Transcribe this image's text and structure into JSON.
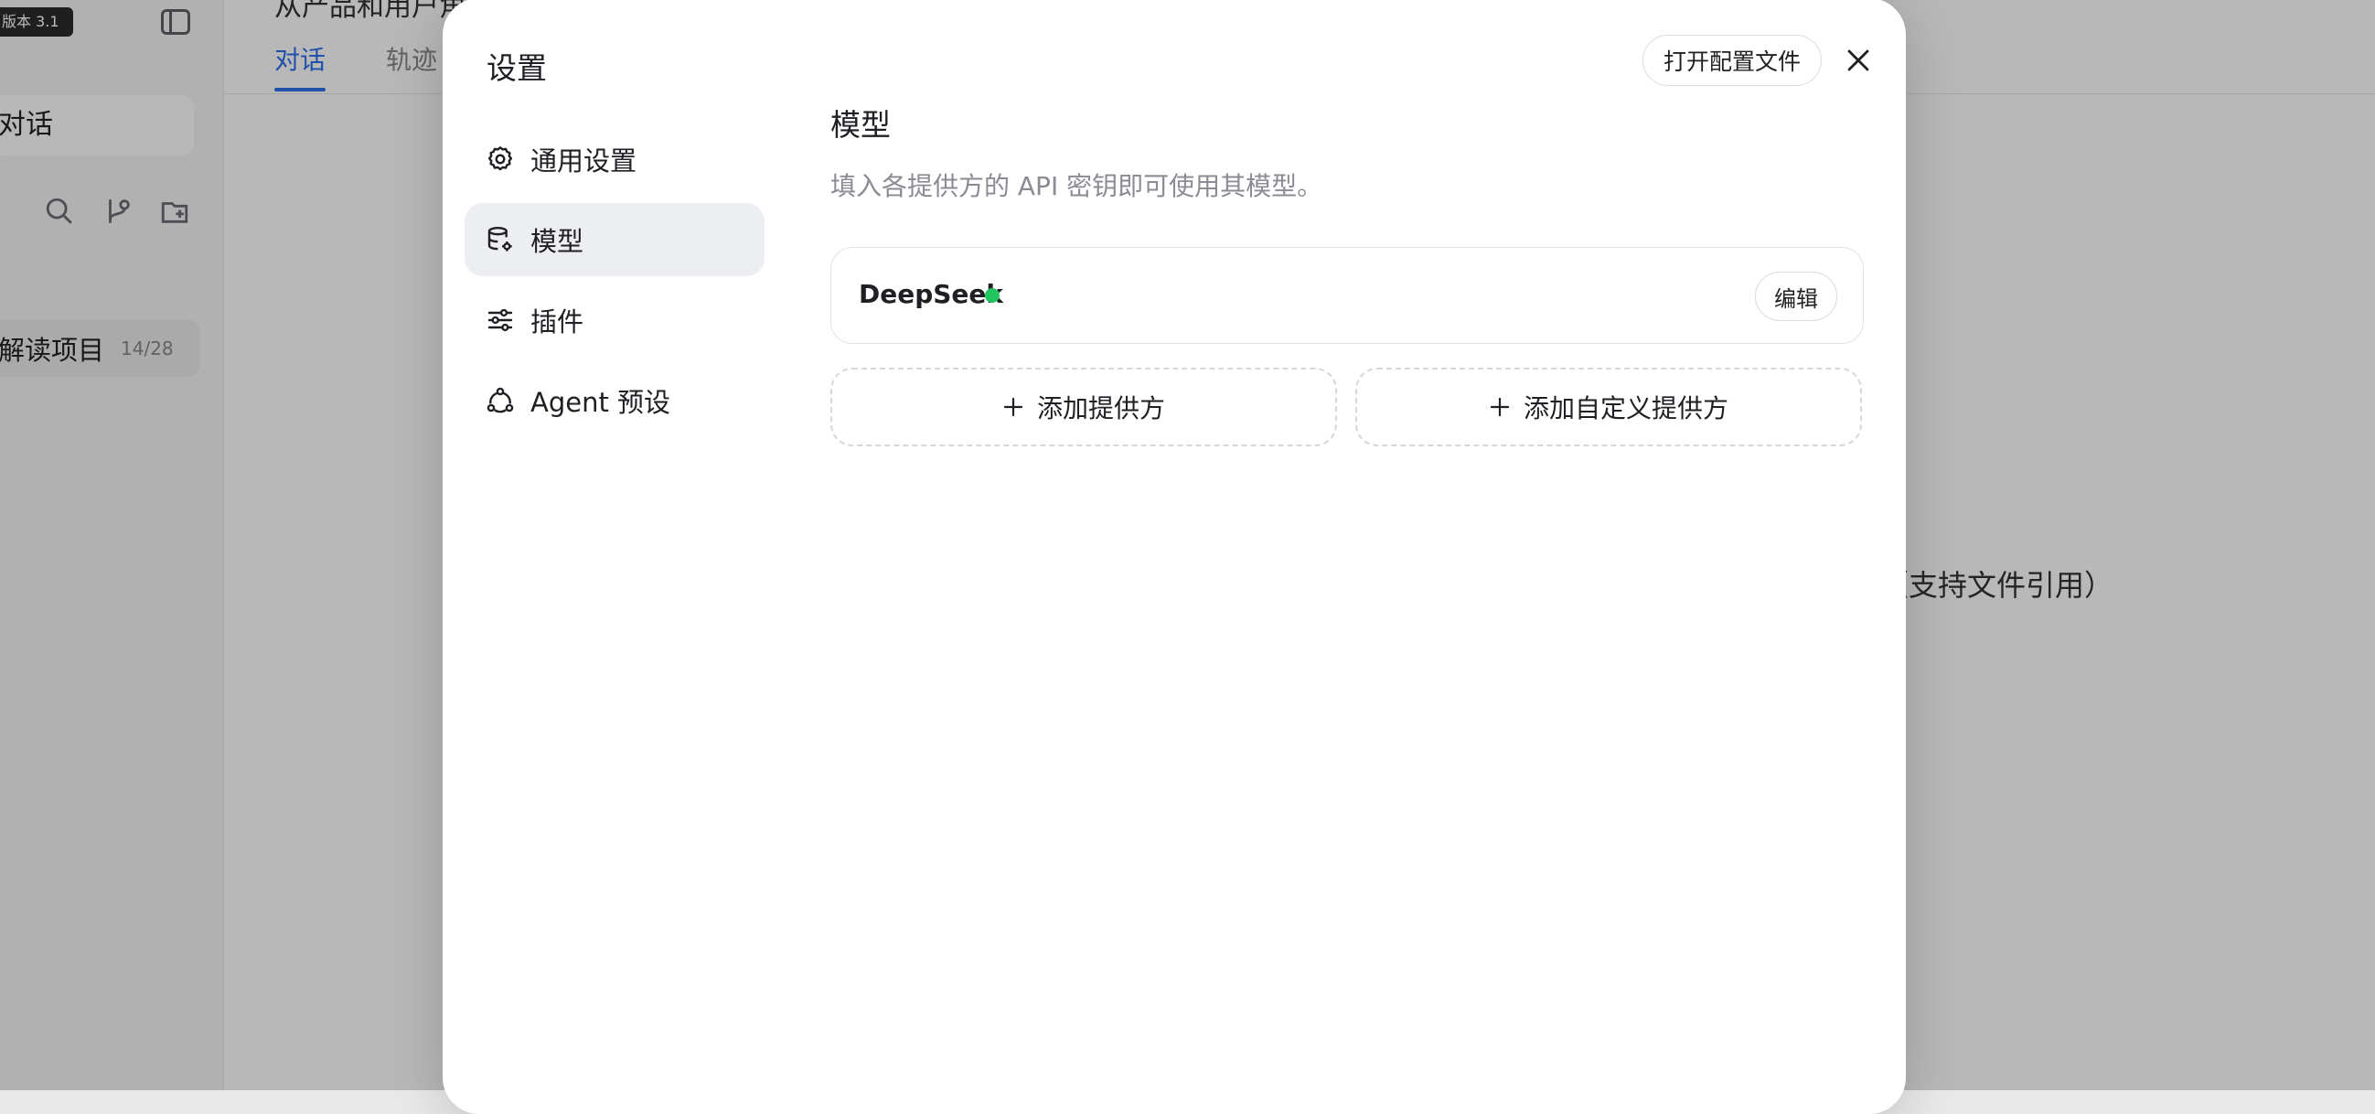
{
  "background": {
    "version_badge": "版本 3.1",
    "search_label": "对话",
    "project_label": "解读项目",
    "project_count": "14/28",
    "header_title": "从产品和用户角度",
    "tabs": [
      {
        "label": "对话",
        "active": true
      },
      {
        "label": "轨迹",
        "active": false
      }
    ],
    "hint": "（支持文件引用）"
  },
  "modal": {
    "title": "设置",
    "open_config_label": "打开配置文件",
    "nav": [
      {
        "label": "通用设置",
        "icon": "gear-icon",
        "active": false
      },
      {
        "label": "模型",
        "icon": "database-gear-icon",
        "active": true
      },
      {
        "label": "插件",
        "icon": "sliders-icon",
        "active": false
      },
      {
        "label": "Agent 预设",
        "icon": "agent-nodes-icon",
        "active": false
      }
    ],
    "section": {
      "title": "模型",
      "description": "填入各提供方的 API 密钥即可使用其模型。"
    },
    "provider": {
      "name": "DeepSeek",
      "status_color": "#22c55e",
      "edit_label": "编辑"
    },
    "add_provider_label": "添加提供方",
    "add_custom_provider_label": "添加自定义提供方"
  },
  "colors": {
    "accent": "#2f6fed",
    "status_active": "#22c55e",
    "nav_active_bg": "#eceef2"
  }
}
